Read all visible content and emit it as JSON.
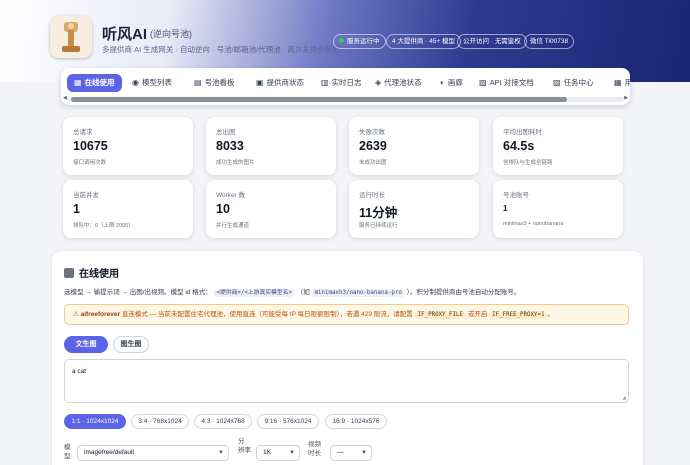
{
  "app": {
    "title": "听风AI",
    "badge": "(逆向号池)",
    "subtitle": "多提供商 AI 生成网关 · 自动逆向 · 号池/邮箱池/代理池 · 高并发异步队列",
    "pills": [
      "服务运行中",
      "4 大提供商 · 45+ 模型",
      "公开访问 · 无需鉴权",
      "微信 Ti00738"
    ]
  },
  "tabs": [
    {
      "icon": "▦",
      "label": "在线使用"
    },
    {
      "icon": "◉",
      "label": "模型列表"
    },
    {
      "icon": "▤",
      "label": "号池看板"
    },
    {
      "icon": "▣",
      "label": "提供商状态"
    },
    {
      "icon": "▥",
      "label": "实时日志"
    },
    {
      "icon": "◈",
      "label": "代理池状态"
    },
    {
      "icon": "◐",
      "label": "画廊"
    },
    {
      "icon": "▧",
      "label": "API 对接文档"
    },
    {
      "icon": "▨",
      "label": "任务中心"
    },
    {
      "icon": "▦",
      "label": "用"
    }
  ],
  "stats": [
    {
      "label": "总请求",
      "value": "10675",
      "desc": "接口调用次数"
    },
    {
      "label": "总出图",
      "value": "8033",
      "desc": "成功生成的图片"
    },
    {
      "label": "失败次数",
      "value": "2639",
      "desc": "未成功出图"
    },
    {
      "label": "平均出图耗时",
      "value": "64.5s",
      "desc": "含排队与生成全链路"
    },
    {
      "label": "当前并发",
      "value": "1",
      "desc": "排队中：0（上限 2000）"
    },
    {
      "label": "Worker 数",
      "value": "10",
      "desc": "并行生成通道"
    },
    {
      "label": "运行时长",
      "value": "11分钟",
      "desc": "服务已持续运行"
    },
    {
      "label": "号池账号",
      "value": "1",
      "desc": "minimax3 + nanobanana"
    }
  ],
  "panel": {
    "title": "在线使用",
    "intro_pre": "选模型 → 输提示词 → 出图/出视频。模型 id 格式：",
    "intro_code1": "<提供商>/<上游真实模型名>",
    "intro_mid": "（如",
    "intro_code2": "minimaxh3/nano-banana-pro",
    "intro_post": "）。积分制提供商由号池自动分配账号。",
    "warn_name": "aifreeforever",
    "warn_pre": "直连模式 — 当前未配置住宅代理池，使用直连（可能受每 IP 每日限额限制），若遇 429 限流，请配置",
    "warn_code1": "IF_PROXY_FILE",
    "warn_mid": "或开启",
    "warn_code2": "IF_FREE_PROXY=1",
    "warn_post": "。",
    "mode_text": "文生图",
    "mode_image": "图生图",
    "prompt_value": "a cat",
    "ratios": [
      "1:1 · 1024x1024",
      "3:4 · 768x1024",
      "4:3 · 1024x768",
      "9:16 · 576x1024",
      "16:9 · 1024x576"
    ],
    "model_label_1": "模",
    "model_label_2": "型",
    "model_value": "imagefree/default",
    "res_label_1": "分",
    "res_label_2": "辨率",
    "res_value": "1K",
    "dur_label_1": "视频",
    "dur_label_2": "时长",
    "dur_value": "—"
  }
}
